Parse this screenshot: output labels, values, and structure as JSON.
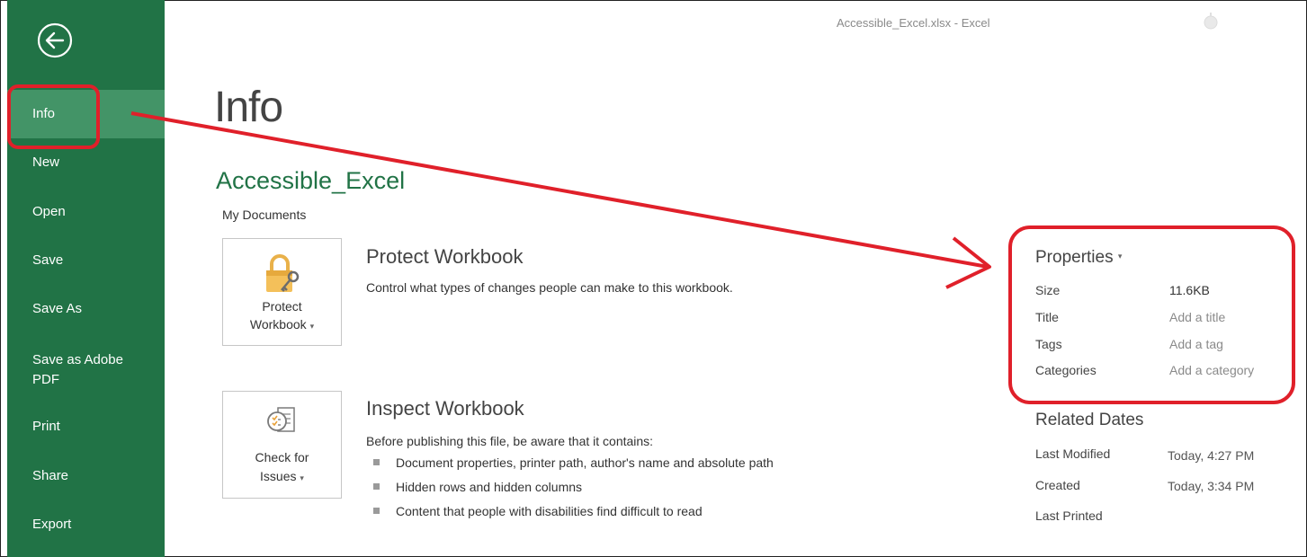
{
  "window": {
    "title": "Accessible_Excel.xlsx - Excel"
  },
  "sidebar": {
    "back_icon": "back-arrow-icon",
    "items": [
      {
        "label": "Info"
      },
      {
        "label": "New"
      },
      {
        "label": "Open"
      },
      {
        "label": "Save"
      },
      {
        "label": "Save As"
      },
      {
        "label": "Save as Adobe PDF"
      },
      {
        "label": "Print"
      },
      {
        "label": "Share"
      },
      {
        "label": "Export"
      }
    ]
  },
  "main": {
    "page_title": "Info",
    "doc_name": "Accessible_Excel",
    "doc_location": "My Documents",
    "protect": {
      "icon": "lock-key-icon",
      "tile_line1": "Protect",
      "tile_line2": "Workbook",
      "heading": "Protect Workbook",
      "description": "Control what types of changes people can make to this workbook."
    },
    "inspect": {
      "icon": "check-document-icon",
      "tile_line1": "Check for",
      "tile_line2": "Issues",
      "heading": "Inspect Workbook",
      "description": "Before publishing this file, be aware that it contains:",
      "bullets": [
        "Document properties, printer path, author's name and absolute path",
        "Hidden rows and hidden columns",
        "Content that people with disabilities find difficult to read"
      ]
    }
  },
  "properties": {
    "heading": "Properties",
    "rows": [
      {
        "label": "Size",
        "value": "11.6KB"
      },
      {
        "label": "Title",
        "value": "Add a title"
      },
      {
        "label": "Tags",
        "value": "Add a tag"
      },
      {
        "label": "Categories",
        "value": "Add a category"
      }
    ]
  },
  "related_dates": {
    "heading": "Related Dates",
    "rows": [
      {
        "label": "Last Modified",
        "value": "Today, 4:27 PM"
      },
      {
        "label": "Created",
        "value": "Today, 3:34 PM"
      },
      {
        "label": "Last Printed",
        "value": ""
      }
    ]
  },
  "colors": {
    "accent": "#217346",
    "active": "#439467",
    "annotation": "#e0202a"
  }
}
